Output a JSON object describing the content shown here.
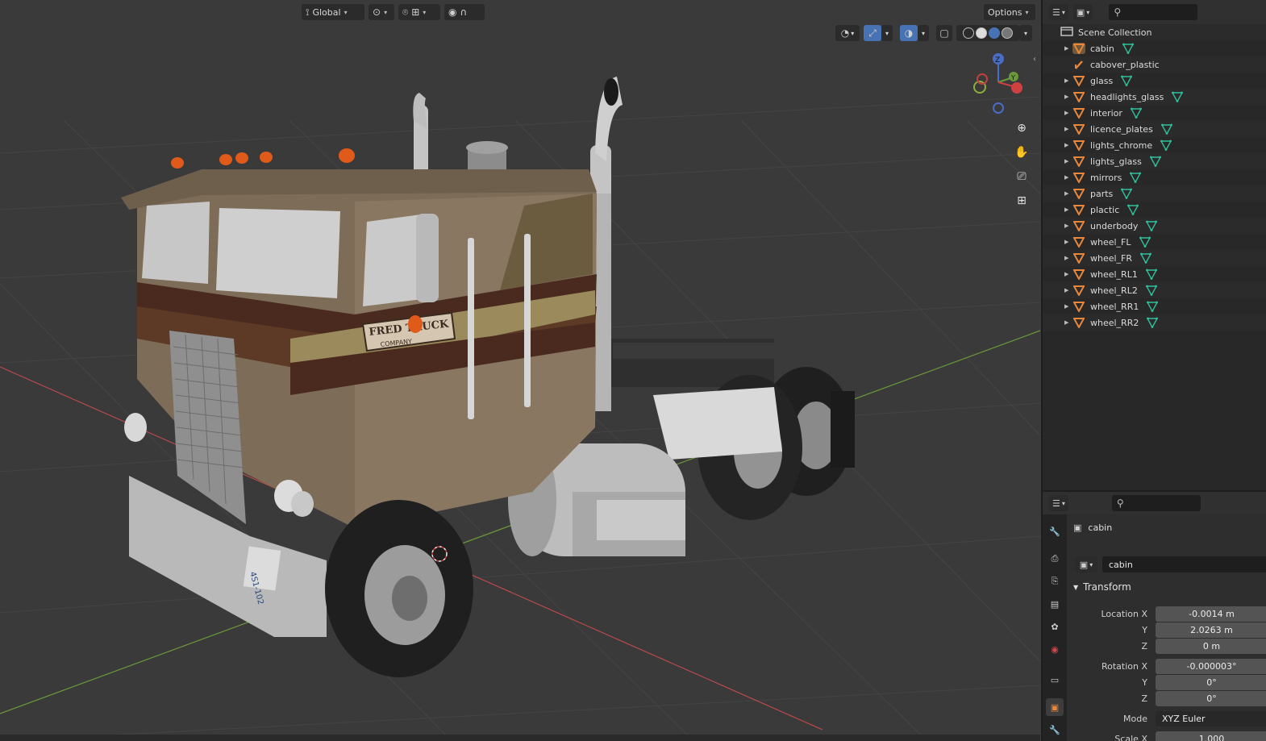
{
  "viewport": {
    "header": {
      "transform_orientation": "Global",
      "options_label": "Options"
    },
    "nav_gizmo_axes": [
      "Z",
      "Y"
    ],
    "truck": {
      "door_logo_line1": "FRED TRUCK",
      "door_logo_line2": "COMPANY",
      "license_plate": "4S1-102"
    }
  },
  "outliner": {
    "scene_collection_label": "Scene Collection",
    "items": [
      {
        "label": "cabin",
        "type": "mesh",
        "expandable": true,
        "selected": true
      },
      {
        "label": "cabover_plastic",
        "type": "armature",
        "expandable": false,
        "selected": false
      },
      {
        "label": "glass",
        "type": "mesh",
        "expandable": true,
        "selected": false
      },
      {
        "label": "headlights_glass",
        "type": "mesh",
        "expandable": true,
        "selected": false
      },
      {
        "label": "interior",
        "type": "mesh",
        "expandable": true,
        "selected": false
      },
      {
        "label": "licence_plates",
        "type": "mesh",
        "expandable": true,
        "selected": false
      },
      {
        "label": "lights_chrome",
        "type": "mesh",
        "expandable": true,
        "selected": false
      },
      {
        "label": "lights_glass",
        "type": "mesh",
        "expandable": true,
        "selected": false
      },
      {
        "label": "mirrors",
        "type": "mesh",
        "expandable": true,
        "selected": false
      },
      {
        "label": "parts",
        "type": "mesh",
        "expandable": true,
        "selected": false
      },
      {
        "label": "plactic",
        "type": "mesh",
        "expandable": true,
        "selected": false
      },
      {
        "label": "underbody",
        "type": "mesh",
        "expandable": true,
        "selected": false
      },
      {
        "label": "wheel_FL",
        "type": "mesh",
        "expandable": true,
        "selected": false
      },
      {
        "label": "wheel_FR",
        "type": "mesh",
        "expandable": true,
        "selected": false
      },
      {
        "label": "wheel_RL1",
        "type": "mesh",
        "expandable": true,
        "selected": false
      },
      {
        "label": "wheel_RL2",
        "type": "mesh",
        "expandable": true,
        "selected": false
      },
      {
        "label": "wheel_RR1",
        "type": "mesh",
        "expandable": true,
        "selected": false
      },
      {
        "label": "wheel_RR2",
        "type": "mesh",
        "expandable": true,
        "selected": false
      }
    ]
  },
  "properties": {
    "object_name_header": "cabin",
    "object_name_field": "cabin",
    "transform_panel_title": "Transform",
    "rows": [
      {
        "label": "Location X",
        "value": "-0.0014 m"
      },
      {
        "label": "Y",
        "value": "2.0263 m"
      },
      {
        "label": "Z",
        "value": "0 m"
      },
      {
        "label": "Rotation X",
        "value": "-0.000003°"
      },
      {
        "label": "Y",
        "value": "0°"
      },
      {
        "label": "Z",
        "value": "0°"
      },
      {
        "label": "Mode",
        "value": "XYZ Euler"
      },
      {
        "label": "Scale X",
        "value": "1.000"
      }
    ]
  },
  "colors": {
    "viewport_bg": "#3a3a3a",
    "axis_x": "#b84a4a",
    "axis_y": "#6a9a3a",
    "mesh_icon": "#e8873a",
    "modifier_icon": "#2fbf9b",
    "active_blue": "#4772b3"
  }
}
